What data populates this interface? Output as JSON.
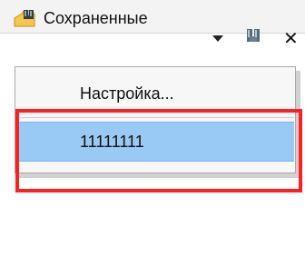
{
  "toolbar": {
    "saved_searches_label": "Сохраненные",
    "close_label": "✕",
    "colors": {
      "background": "#f3f3f3",
      "line": "#d6d6d6"
    }
  },
  "menu": {
    "items": [
      {
        "label": "Настройка..."
      },
      {
        "label": "11111111",
        "selected": true
      }
    ],
    "colors": {
      "background": "#f7f7f7",
      "selected_fill": "#99c9f5",
      "selected_border": "#78b4ef",
      "border": "#a9a9a9"
    }
  },
  "annotation": {
    "highlight_color": "#ff1f1f"
  },
  "icons": {
    "saved": "binoculars-folder-icon",
    "find": "binoculars-icon",
    "dropdown": "dropdown-arrow-icon",
    "close": "close-icon"
  }
}
